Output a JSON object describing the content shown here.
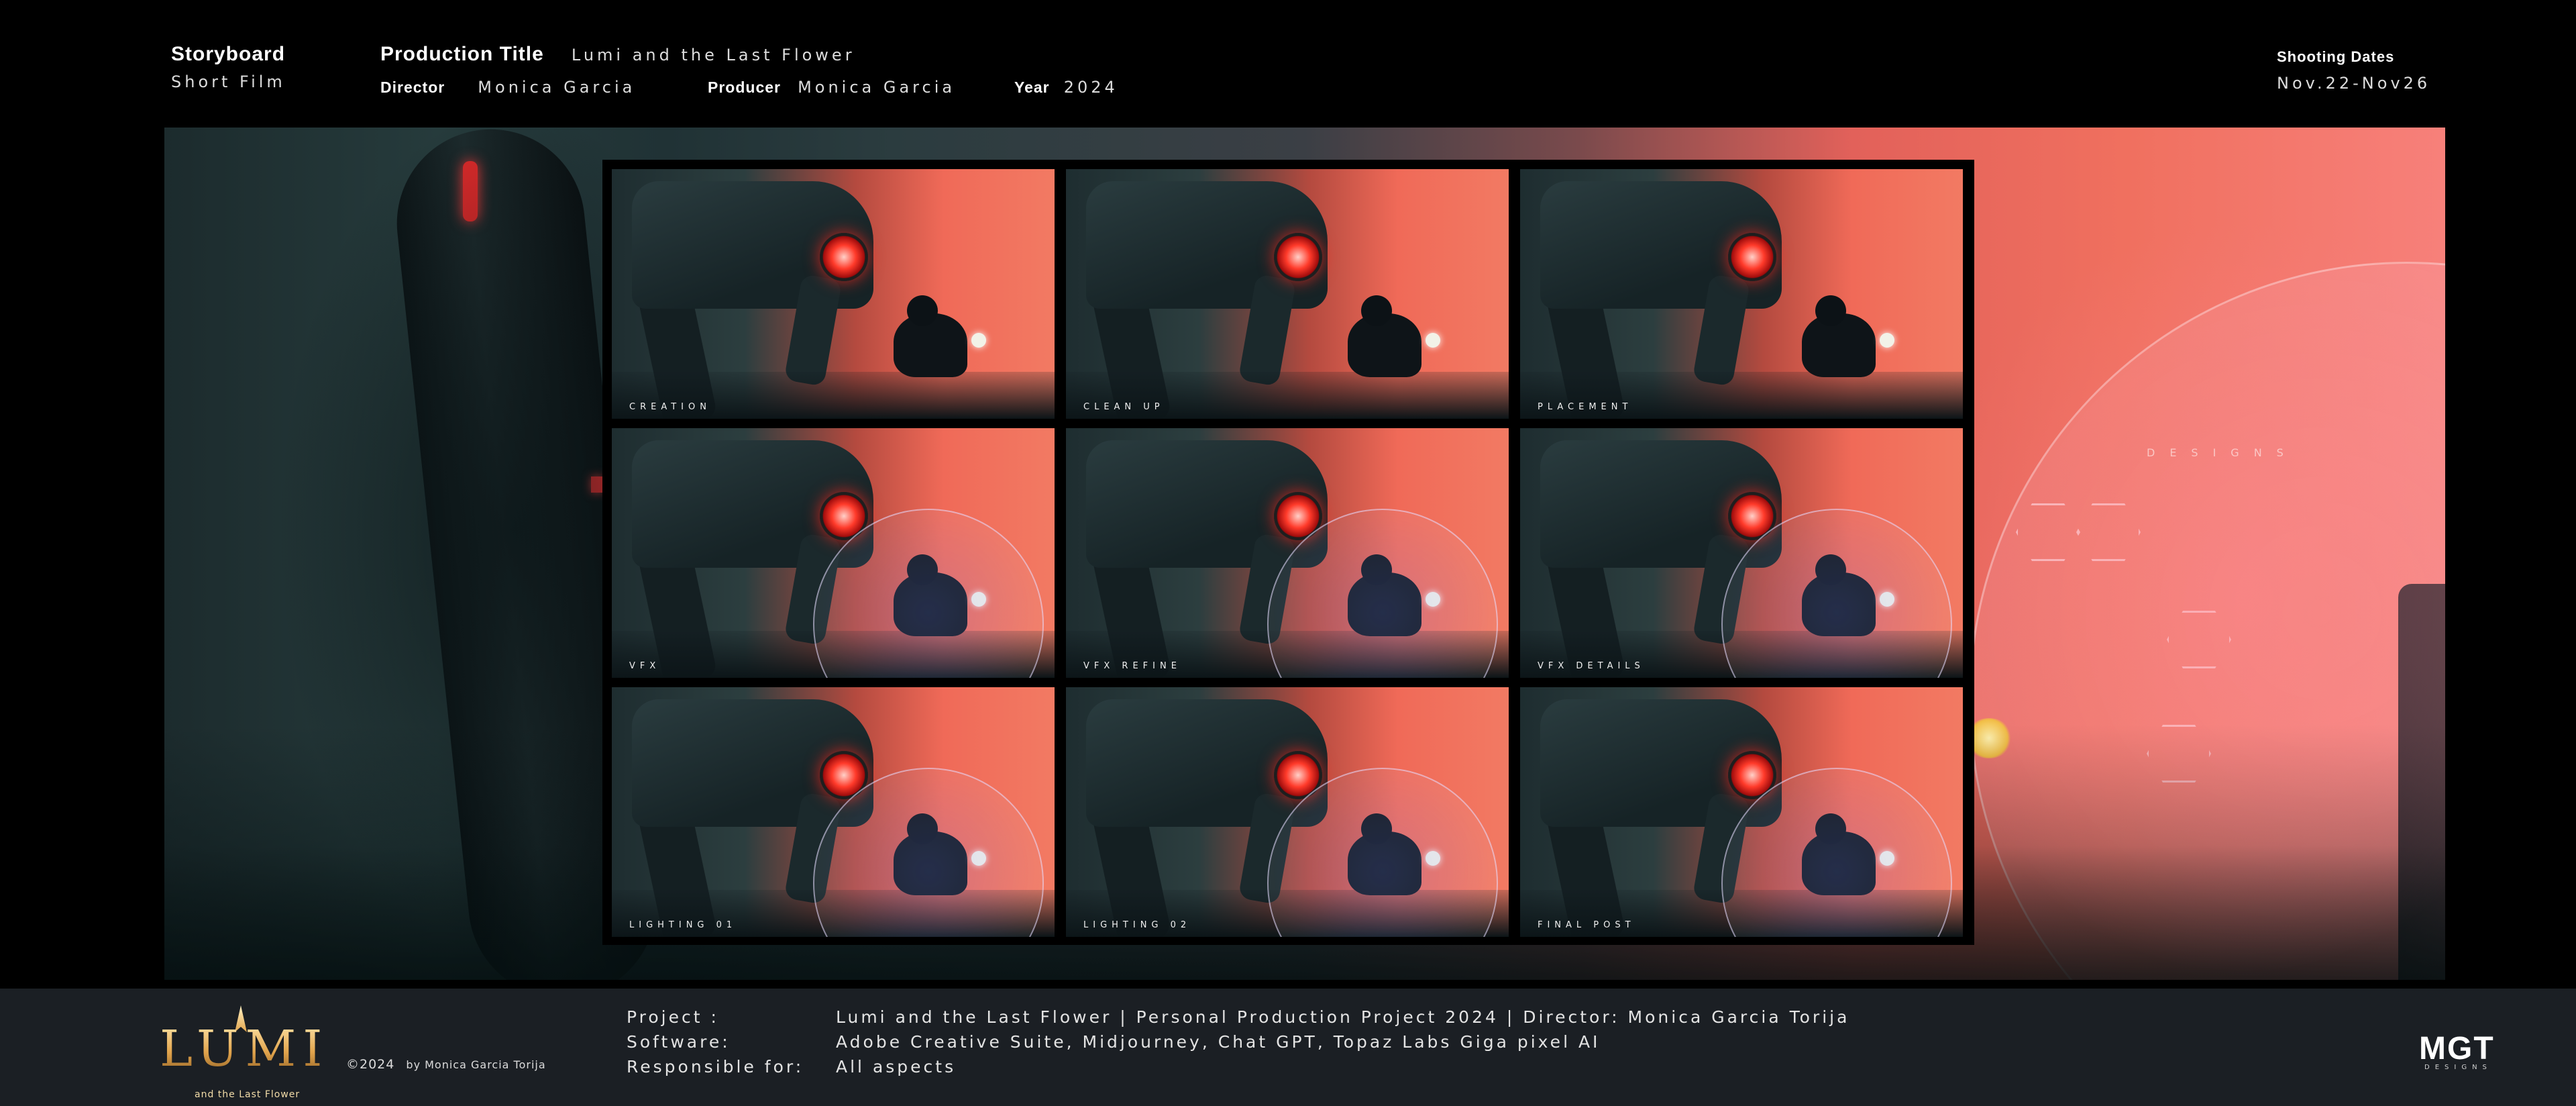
{
  "header": {
    "storyboard_label": "Storyboard",
    "type": "Short Film",
    "production_title_label": "Production Title",
    "production_title": "Lumi and the Last Flower",
    "director_label": "Director",
    "director": "Monica Garcia",
    "producer_label": "Producer",
    "producer": "Monica Garcia",
    "year_label": "Year",
    "year": "2024",
    "shooting_dates_label": "Shooting Dates",
    "shooting_dates": "Nov.22-Nov26"
  },
  "hero": {
    "watermark": "DESIGNS"
  },
  "frames": [
    {
      "label": "CREATION",
      "bubble": false
    },
    {
      "label": "CLEAN UP",
      "bubble": false
    },
    {
      "label": "PLACEMENT",
      "bubble": false
    },
    {
      "label": "VFX",
      "bubble": true
    },
    {
      "label": "VFX REFINE",
      "bubble": true
    },
    {
      "label": "VFX DETAILS",
      "bubble": true
    },
    {
      "label": "LIGHTING 01",
      "bubble": true
    },
    {
      "label": "LIGHTING 02",
      "bubble": true
    },
    {
      "label": "FINAL POST",
      "bubble": true
    }
  ],
  "footer": {
    "logo_text": "LUMI",
    "logo_sub": "and the Last Flower",
    "copyright": "©2024",
    "copyright_by": "by Monica Garcia Torija",
    "project_label": "Project :",
    "project_value": "Lumi and the Last Flower | Personal Production Project 2024 | Director: Monica Garcia Torija",
    "software_label": "Software:",
    "software_value": "Adobe Creative Suite, Midjourney, Chat GPT, Topaz Labs Giga pixel AI",
    "responsible_label": "Responsible for:",
    "responsible_value": "All aspects",
    "brand": "MGT",
    "brand_sub": "DESIGNS"
  },
  "colors": {
    "background": "#000000",
    "footer_bg": "#1b1f24",
    "accent_red": "#f06a58",
    "eye_red": "#ff3a2a"
  }
}
